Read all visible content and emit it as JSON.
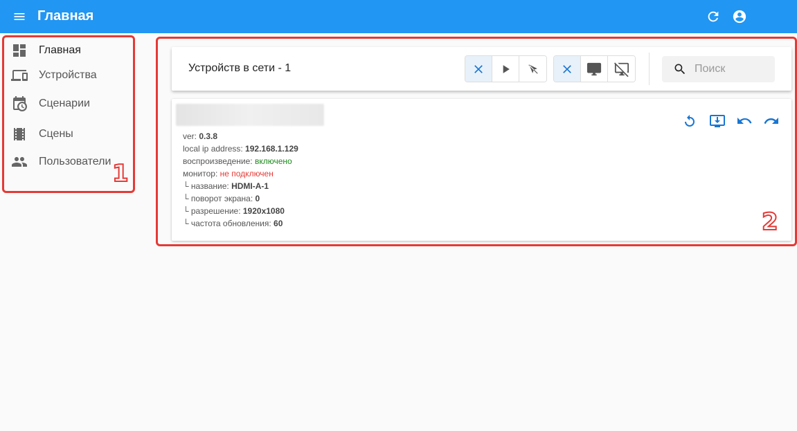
{
  "appbar": {
    "title": "Главная",
    "menu_icon": "menu-icon",
    "refresh_icon": "refresh-icon",
    "account_icon": "account-icon"
  },
  "sidebar": {
    "items": [
      {
        "label": "Главная",
        "icon": "dashboard-icon",
        "active": true
      },
      {
        "label": "Устройства",
        "icon": "devices-icon",
        "active": false
      },
      {
        "label": "Сценарии",
        "icon": "calendar-clock-icon",
        "active": false
      },
      {
        "label": "Сцены",
        "icon": "film-icon",
        "active": false
      },
      {
        "label": "Пользователи",
        "icon": "users-icon",
        "active": false
      }
    ]
  },
  "annotations": {
    "label_1": "1",
    "label_2": "2",
    "color": "#e53935"
  },
  "toolbar": {
    "count_text": "Устройств в сети - 1",
    "playback_filter": [
      "clear-filter-icon",
      "play-icon",
      "pointer-off-icon"
    ],
    "monitor_filter": [
      "clear-filter-icon",
      "monitor-icon",
      "monitor-off-icon"
    ],
    "search_placeholder": "Поиск",
    "search_value": ""
  },
  "device": {
    "ver_label": "ver: ",
    "ver_value": "0.3.8",
    "ip_label": "local ip address: ",
    "ip_value": "192.168.1.129",
    "playback_label": "воспроизведение: ",
    "playback_value": "включено",
    "monitor_label": "монитор: ",
    "monitor_value": "не подключен",
    "name_label": "└ название: ",
    "name_value": "HDMI-A-1",
    "rotation_label": "└ поворот экрана: ",
    "rotation_value": "0",
    "resolution_label": "└ разрешение: ",
    "resolution_value": "1920x1080",
    "refresh_label": "└ частота обновления: ",
    "refresh_value": "60",
    "actions": [
      "restart-icon",
      "download-icon",
      "undo-icon",
      "redo-icon"
    ]
  },
  "colors": {
    "primary": "#2196f3",
    "accent_icon": "#1976d2",
    "ok": "#1b8a1b",
    "bad": "#e53935"
  }
}
